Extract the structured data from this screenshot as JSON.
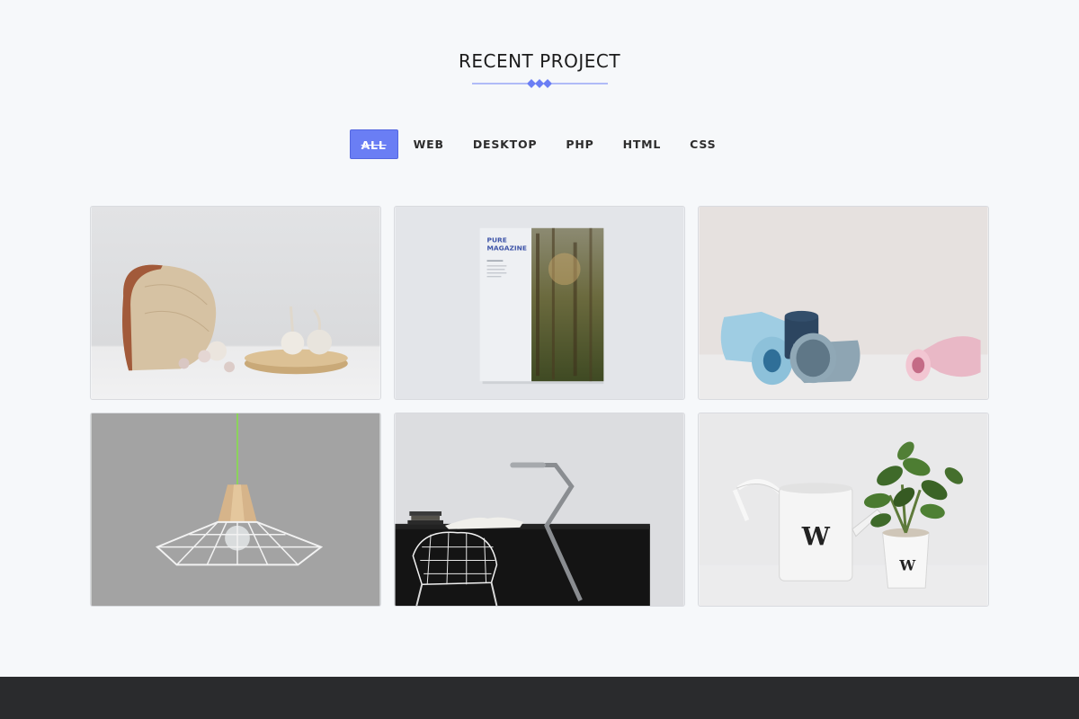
{
  "section": {
    "title": "RECENT PROJECT"
  },
  "filters": [
    {
      "label": "ALL",
      "active": true
    },
    {
      "label": "WEB",
      "active": false
    },
    {
      "label": "DESKTOP",
      "active": false
    },
    {
      "label": "PHP",
      "active": false
    },
    {
      "label": "HTML",
      "active": false
    },
    {
      "label": "CSS",
      "active": false
    }
  ],
  "projects": [
    {
      "subject": "wooden board with garlic",
      "icon": "garlic-board-image"
    },
    {
      "subject": "magazine mockup",
      "icon": "magazine-image",
      "cover_title": "PURE",
      "cover_subtitle": "MAGAZINE"
    },
    {
      "subject": "ceramic pots",
      "icon": "ceramic-pots-image"
    },
    {
      "subject": "wire pendant lamp",
      "icon": "pendant-lamp-image"
    },
    {
      "subject": "desk with wire chair and lamp",
      "icon": "desk-workspace-image"
    },
    {
      "subject": "watering can and plant pot",
      "icon": "watering-can-image",
      "logo_letter": "W"
    }
  ],
  "colors": {
    "accent": "#6a7ef4",
    "page_bg": "#f6f8fa",
    "footer_bg": "#2a2b2d"
  }
}
